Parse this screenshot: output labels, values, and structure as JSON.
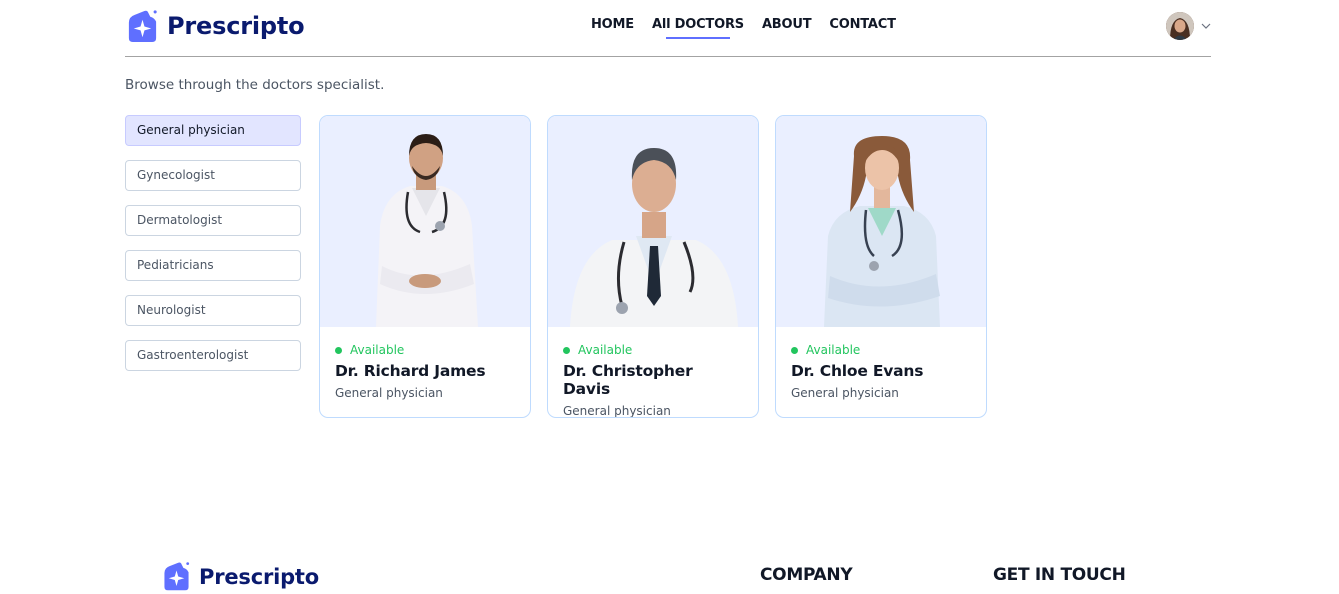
{
  "brand": {
    "name": "Prescripto",
    "color": "#5f6fff",
    "text_color": "#0a1a6e"
  },
  "nav": {
    "links": [
      {
        "label": "HOME",
        "active": false
      },
      {
        "label": "All DOCTORS",
        "active": true
      },
      {
        "label": "ABOUT",
        "active": false
      },
      {
        "label": "CONTACT",
        "active": false
      }
    ],
    "profile_icon": "chevron-down-icon"
  },
  "page": {
    "subtitle": "Browse through the doctors specialist."
  },
  "filters": [
    {
      "label": "General physician",
      "active": true
    },
    {
      "label": "Gynecologist",
      "active": false
    },
    {
      "label": "Dermatologist",
      "active": false
    },
    {
      "label": "Pediatricians",
      "active": false
    },
    {
      "label": "Neurologist",
      "active": false
    },
    {
      "label": "Gastroenterologist",
      "active": false
    }
  ],
  "doctors": [
    {
      "status": "Available",
      "name": "Dr. Richard James",
      "speciality": "General physician"
    },
    {
      "status": "Available",
      "name": "Dr. Christopher Davis",
      "speciality": "General physician"
    },
    {
      "status": "Available",
      "name": "Dr. Chloe Evans",
      "speciality": "General physician"
    }
  ],
  "footer": {
    "brand": "Prescripto",
    "company_heading": "COMPANY",
    "contact_heading": "GET IN TOUCH"
  },
  "colors": {
    "available": "#22c55e",
    "filter_active_bg": "#e2e5ff",
    "card_photo_bg": "#eaefff"
  }
}
